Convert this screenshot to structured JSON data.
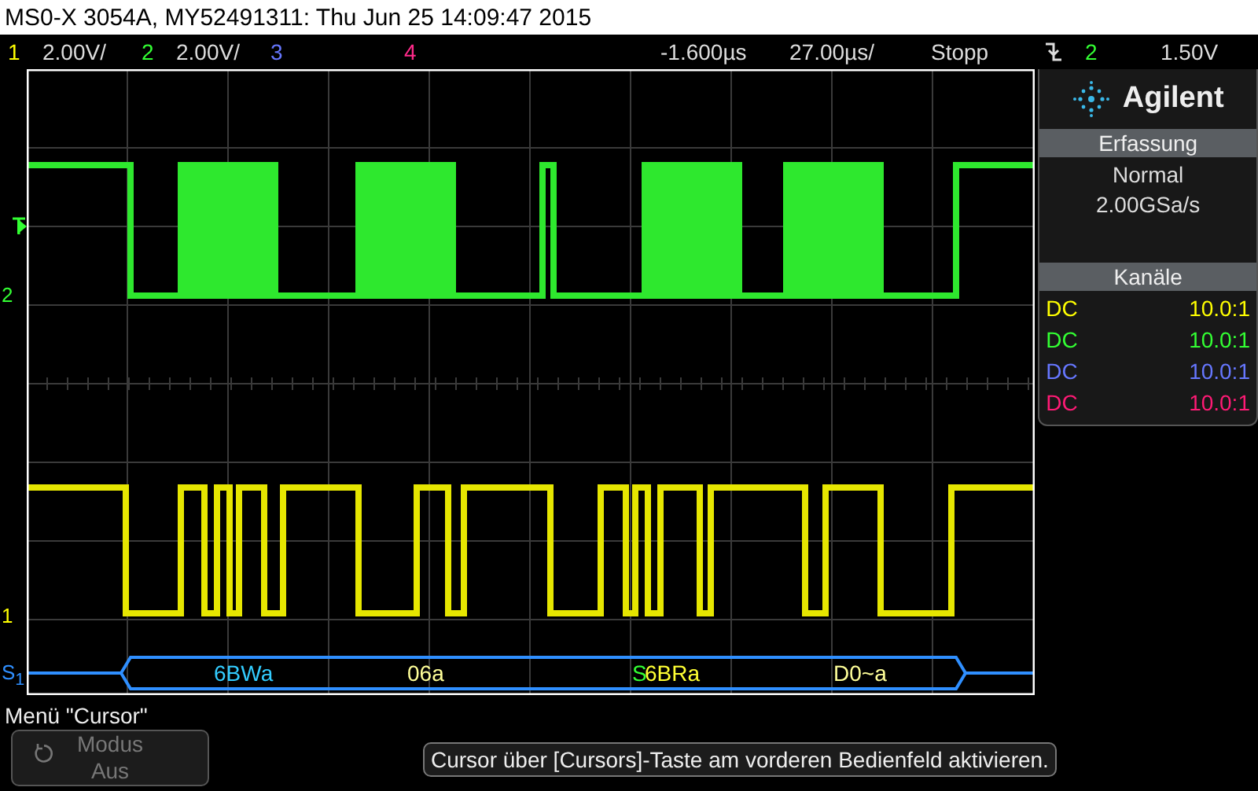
{
  "title": "MS0-X 3054A, MY52491311: Thu Jun 25 14:09:47 2015",
  "status_bar": {
    "channels": [
      {
        "number": "1",
        "scale": "2.00V/",
        "color": "#ffff00"
      },
      {
        "number": "2",
        "scale": "2.00V/",
        "color": "#33ff33"
      },
      {
        "number": "3",
        "color": "#6677ff"
      },
      {
        "number": "4",
        "color": "#ff2a8a"
      }
    ],
    "delay": "-1.600µs",
    "timebase": "27.00µs/",
    "run_state": "Stopp",
    "trigger_source": "2",
    "trigger_level": "1.50V"
  },
  "plot": {
    "markers": [
      {
        "text": "2",
        "color": "#33ff33"
      },
      {
        "text": "1",
        "color": "#ffff00"
      },
      {
        "text": "S$_{1}$",
        "color": "#2f8fff"
      }
    ],
    "decode": [
      {
        "text": "6BWa",
        "color": "#33ccff"
      },
      {
        "text": "06a",
        "color": "#ffff99"
      },
      {
        "text": "S",
        "color": "#33ff33"
      },
      {
        "text": "6BRa",
        "color": "#ffff33"
      },
      {
        "text": "D0~a",
        "color": "#ffff99"
      }
    ]
  },
  "panel": {
    "brand": "Agilent",
    "acquisition": {
      "title": "Erfassung",
      "lines": [
        "Normal",
        "2.00GSa/s"
      ]
    },
    "channels": {
      "title": "Kanäle",
      "rows": [
        {
          "coupling": "DC",
          "probe": "10.0:1",
          "color": "#ffff00"
        },
        {
          "coupling": "DC",
          "probe": "10.0:1",
          "color": "#33ff33"
        },
        {
          "coupling": "DC",
          "probe": "10.0:1",
          "color": "#6677ff"
        },
        {
          "coupling": "DC",
          "probe": "10.0:1",
          "color": "#ff1a75"
        }
      ]
    }
  },
  "menu": {
    "title": "Menü \"Cursor\"",
    "softkeys": [
      {
        "label": "Modus",
        "value": "Aus",
        "disabled": true
      }
    ],
    "message": "Cursor über [Cursors]-Taste am vorderen Bedienfeld aktivieren."
  }
}
